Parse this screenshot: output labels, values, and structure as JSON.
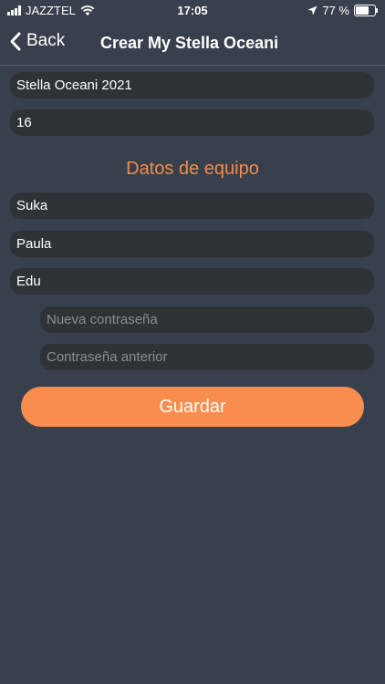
{
  "status": {
    "carrier": "JAZZTEL",
    "time": "17:05",
    "battery": "77 %",
    "battery_level": 0.77,
    "icons": [
      "signal-icon",
      "wifi-icon",
      "location-arrow-icon",
      "battery-icon"
    ]
  },
  "nav": {
    "back_label": "Back",
    "title": "Crear My Stella Oceani"
  },
  "form": {
    "name_value": "Stella Oceani 2021",
    "number_value": "16",
    "section_title": "Datos de equipo",
    "members": [
      "Suka",
      "Paula",
      "Edu"
    ],
    "new_password_placeholder": "Nueva contraseña",
    "old_password_placeholder": "Contraseña anterior",
    "save_label": "Guardar"
  },
  "colors": {
    "background": "#38404d",
    "field": "#2f3338",
    "accent": "#f98d4d"
  }
}
